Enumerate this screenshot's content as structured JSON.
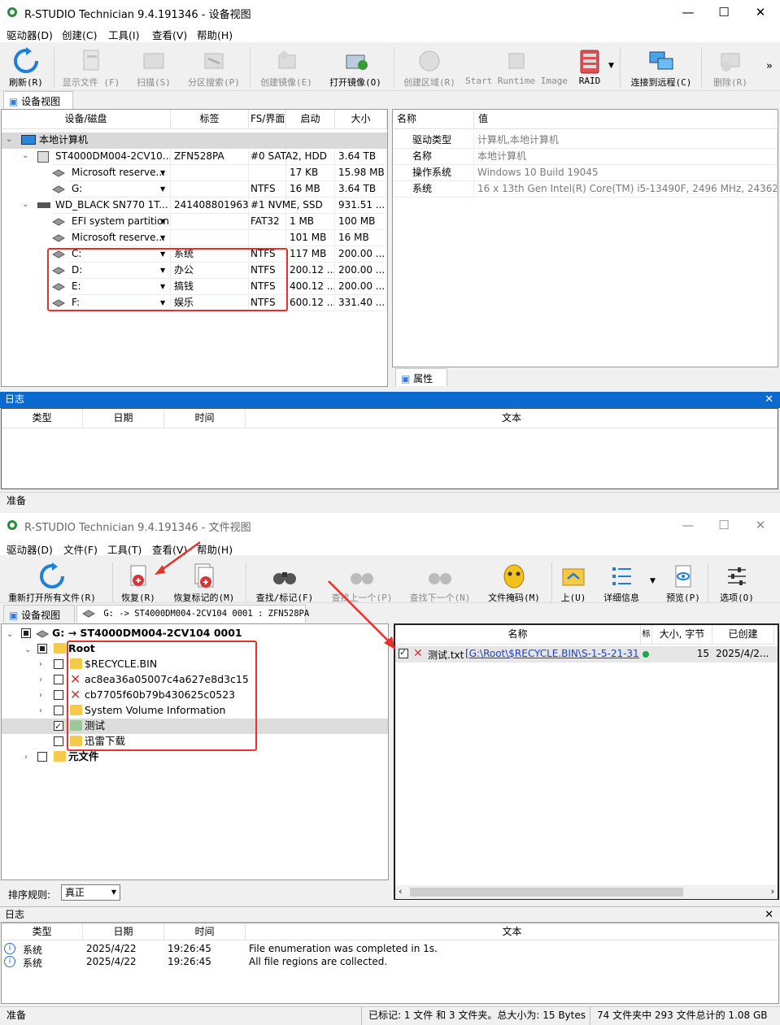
{
  "w1": {
    "title": "R-STUDIO Technician 9.4.191346 - 设备视图",
    "menu": [
      "驱动器(D)",
      "创建(C)",
      "工具(I)",
      "查看(V)",
      "帮助(H)"
    ],
    "toolbar": [
      "刷新(R)",
      "显示文件 (F)",
      "扫描(S)",
      "分区搜索(P)",
      "创建镜像(E)",
      "打开镜像(O)",
      "创建区域(R)",
      "Start Runtime Image",
      "RAID",
      "连接到远程(C)",
      "删除(R)",
      "»"
    ],
    "tab": "设备视图",
    "dev_headers": [
      "设备/磁盘",
      "标签",
      "FS/界面",
      "启动",
      "大小"
    ],
    "dev_rows": [
      {
        "name": "本地计算机",
        "label": "",
        "fs": "",
        "start": "",
        "size": ""
      },
      {
        "name": "ST4000DM004-2CV10...",
        "label": "ZFN528PA",
        "fs": "#0 SATA2, HDD",
        "start": "",
        "size": "3.64 TB"
      },
      {
        "name": "Microsoft reserve...",
        "label": "",
        "fs": "",
        "start": "17 KB",
        "size": "15.98 MB"
      },
      {
        "name": "G:",
        "label": "",
        "fs": "NTFS",
        "start": "16 MB",
        "size": "3.64 TB"
      },
      {
        "name": "WD_BLACK SN770 1T...",
        "label": "241408801963",
        "fs": "#1 NVME, SSD",
        "start": "",
        "size": "931.51 ..."
      },
      {
        "name": "EFI system partition",
        "label": "",
        "fs": "FAT32",
        "start": "1 MB",
        "size": "100 MB"
      },
      {
        "name": "Microsoft reserve...",
        "label": "",
        "fs": "",
        "start": "101 MB",
        "size": "16 MB"
      },
      {
        "name": "C:",
        "label": "系统",
        "fs": "NTFS",
        "start": "117 MB",
        "size": "200.00 ..."
      },
      {
        "name": "D:",
        "label": "办公",
        "fs": "NTFS",
        "start": "200.12 ...",
        "size": "200.00 ..."
      },
      {
        "name": "E:",
        "label": "搞钱",
        "fs": "NTFS",
        "start": "400.12 ...",
        "size": "200.00 ..."
      },
      {
        "name": "F:",
        "label": "娱乐",
        "fs": "NTFS",
        "start": "600.12 ...",
        "size": "331.40 ..."
      }
    ],
    "prop_headers": [
      "名称",
      "值"
    ],
    "props": [
      {
        "k": "驱动类型",
        "v": "计算机,本地计算机"
      },
      {
        "k": "名称",
        "v": "本地计算机"
      },
      {
        "k": "操作系统",
        "v": "Windows 10 Build 19045"
      },
      {
        "k": "系统",
        "v": "16 x 13th Gen Intel(R) Core(TM) i5-13490F, 2496 MHz, 24362 ..."
      }
    ],
    "prop_tab": "属性",
    "log_title": "日志",
    "log_headers": [
      "类型",
      "日期",
      "时间",
      "文本"
    ],
    "status": "准备"
  },
  "w2": {
    "title": "R-STUDIO Technician 9.4.191346 - 文件视图",
    "menu": [
      "驱动器(D)",
      "文件(F)",
      "工具(T)",
      "查看(V)",
      "帮助(H)"
    ],
    "toolbar": [
      "重新打开所有文件(R)",
      "恢复(R)",
      "恢复标记的(M)",
      "查找/标记(F)",
      "查找上一个(P)",
      "查找下一个(N)",
      "文件掩码(M)",
      "上(U)",
      "详细信息",
      "预览(P)",
      "选项(O)"
    ],
    "tabs": [
      "设备视图",
      "G: -> ST4000DM004-2CV104 0001 : ZFN528PA"
    ],
    "tree": [
      "G: → ST4000DM004-2CV104 0001",
      "Root",
      "$RECYCLE.BIN",
      "ac8ea36a05007c4a627e8d3c15",
      "cb7705f60b79b430625c0523",
      "System Volume Information",
      "测试",
      "迅雷下载",
      "元文件"
    ],
    "sort_label": "排序规则:",
    "sort_value": "真正",
    "file_headers": [
      "名称",
      "标",
      "大小, 字节",
      "已创建"
    ],
    "file_row": {
      "name": "测试.txt",
      "path": "[G:\\Root\\$RECYCLE.BIN\\S-1-5-21-31(",
      "size": "15",
      "created": "2025/4/2..."
    },
    "log_title": "日志",
    "log_headers": [
      "类型",
      "日期",
      "时间",
      "文本"
    ],
    "log_rows": [
      {
        "type": "系统",
        "date": "2025/4/22",
        "time": "19:26:45",
        "text": "File enumeration was completed in 1s."
      },
      {
        "type": "系统",
        "date": "2025/4/22",
        "time": "19:26:45",
        "text": "All file regions are collected."
      }
    ],
    "status_left": "准备",
    "status_mid": "已标记: 1 文件 和 3 文件夹。总大小为: 15 Bytes",
    "status_right": "74 文件夹中 293 文件总计的 1.08 GB"
  }
}
